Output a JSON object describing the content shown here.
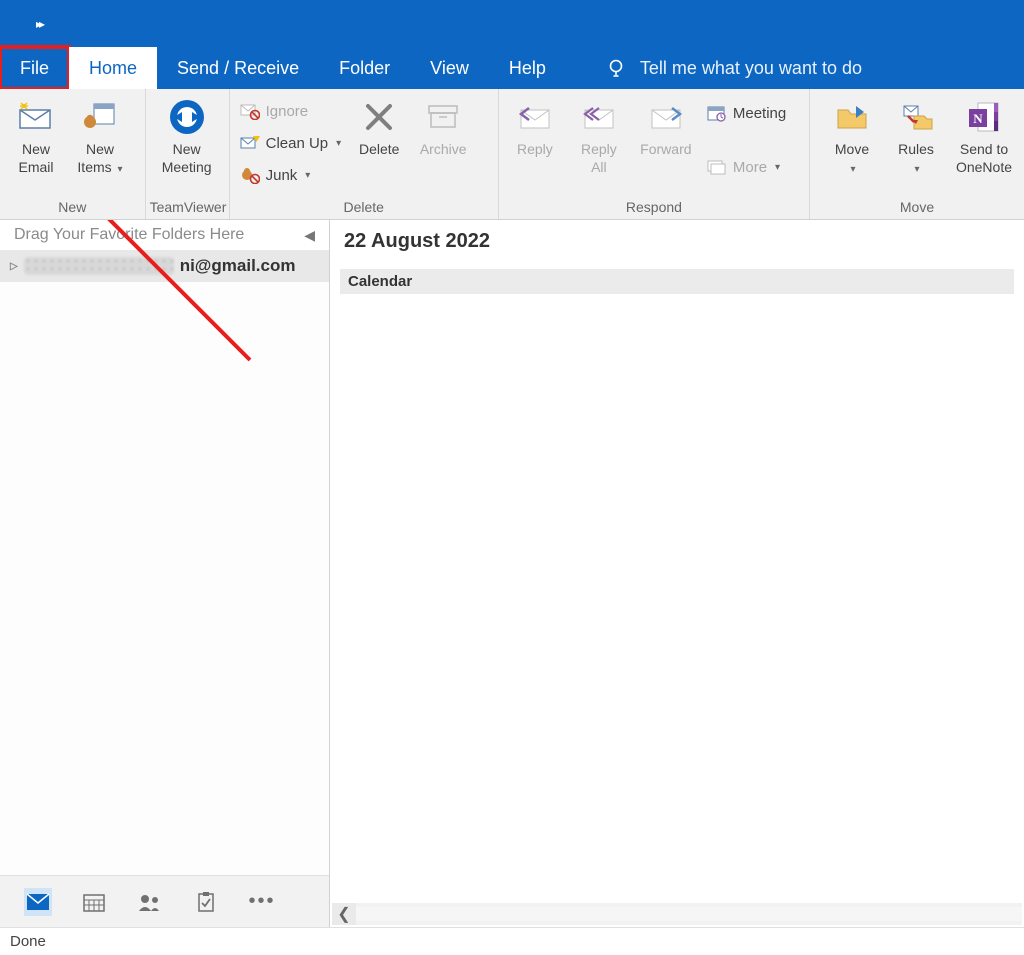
{
  "menu": {
    "file": "File",
    "home": "Home",
    "send_receive": "Send / Receive",
    "folder": "Folder",
    "view": "View",
    "help": "Help",
    "tellme": "Tell me what you want to do"
  },
  "ribbon": {
    "new_group": "New",
    "new_email": "New\nEmail",
    "new_items": "New\nItems",
    "teamviewer_group": "TeamViewer",
    "new_meeting": "New\nMeeting",
    "delete_group": "Delete",
    "ignore": "Ignore",
    "clean_up": "Clean Up",
    "junk": "Junk",
    "delete": "Delete",
    "archive": "Archive",
    "respond_group": "Respond",
    "reply": "Reply",
    "reply_all": "Reply\nAll",
    "forward": "Forward",
    "meeting": "Meeting",
    "more": "More",
    "move_group": "Move",
    "move": "Move",
    "rules": "Rules",
    "send_onenote": "Send to\nOneNote"
  },
  "nav": {
    "favorites_hint": "Drag Your Favorite Folders Here",
    "account_suffix": "ni@gmail.com"
  },
  "content": {
    "date": "22 August 2022",
    "calendar_header": "Calendar"
  },
  "status": {
    "text": "Done"
  }
}
